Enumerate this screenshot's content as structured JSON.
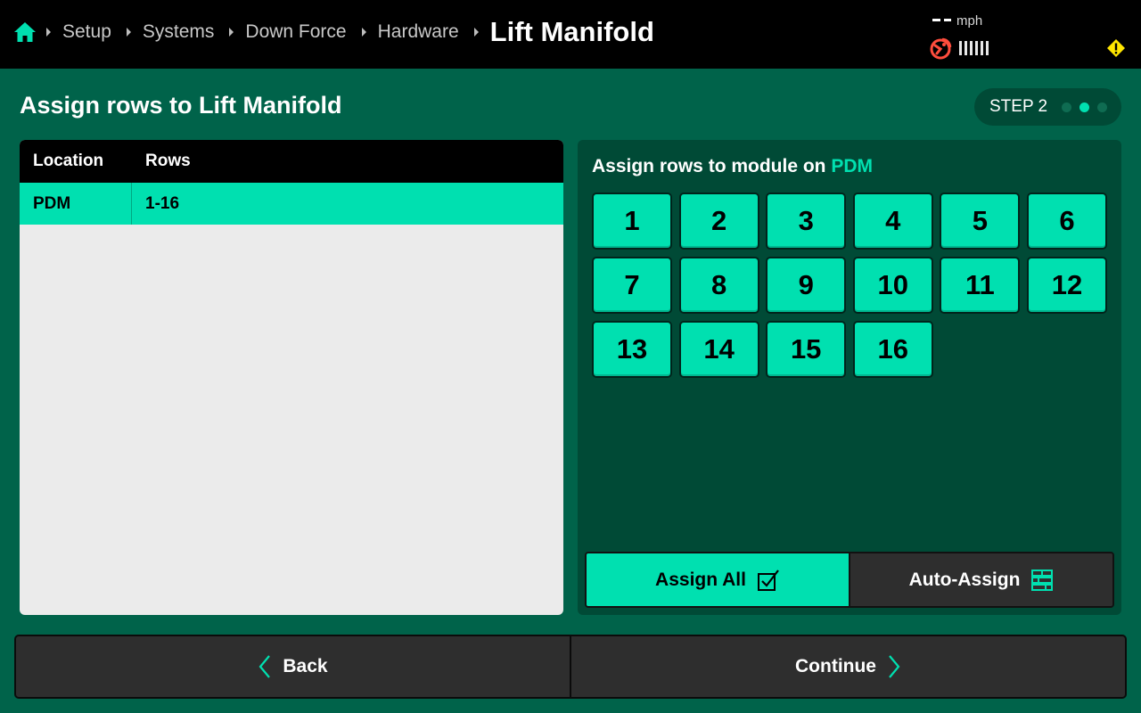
{
  "header": {
    "breadcrumbs": [
      "Setup",
      "Systems",
      "Down Force",
      "Hardware"
    ],
    "current": "Lift Manifold",
    "speed_value": "--",
    "speed_unit": "mph",
    "icons": [
      "home-icon",
      "gps-icon",
      "signal-bars-icon",
      "warning-icon"
    ]
  },
  "page": {
    "title": "Assign rows to Lift Manifold",
    "step_label": "STEP 2",
    "step_total": 3,
    "step_active": 2
  },
  "table": {
    "columns": [
      "Location",
      "Rows"
    ],
    "rows": [
      {
        "location": "PDM",
        "rows": "1-16"
      }
    ]
  },
  "assign": {
    "title_prefix": "Assign rows to module on",
    "module": "PDM",
    "row_numbers": [
      "1",
      "2",
      "3",
      "4",
      "5",
      "6",
      "7",
      "8",
      "9",
      "10",
      "11",
      "12",
      "13",
      "14",
      "15",
      "16"
    ],
    "assign_all_label": "Assign All",
    "auto_assign_label": "Auto-Assign"
  },
  "nav": {
    "back_label": "Back",
    "continue_label": "Continue"
  },
  "colors": {
    "background": "#00634a",
    "panel": "#004a36",
    "accent": "#00e0b0",
    "topbar": "#000000",
    "gps_alert": "#ff4d3d",
    "warning": "#ffe600"
  }
}
